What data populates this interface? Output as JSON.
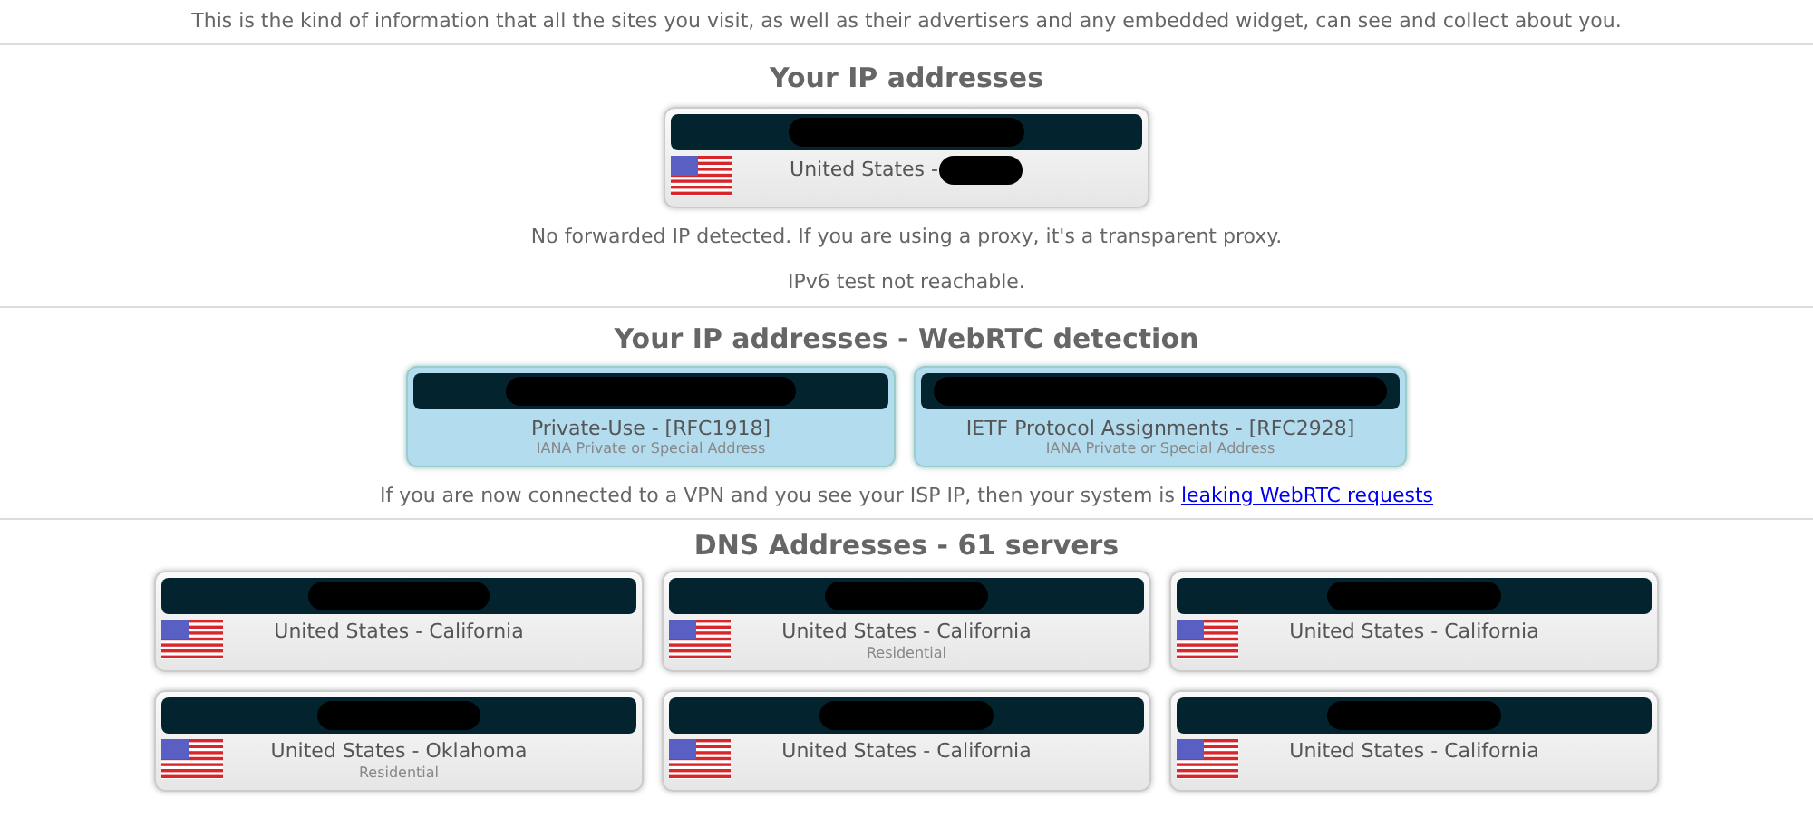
{
  "intro": "This is the kind of information that all the sites you visit, as well as their advertisers and any embedded widget, can see and collect about you.",
  "ip_section": {
    "title": "Your IP addresses",
    "cards": [
      {
        "location": "United States -"
      }
    ],
    "notes": [
      "No forwarded IP detected. If you are using a proxy, it's a transparent proxy.",
      "IPv6 test not reachable."
    ]
  },
  "webrtc_section": {
    "title": "Your IP addresses - WebRTC detection",
    "cards": [
      {
        "title": "Private-Use - [RFC1918]",
        "subtitle": "IANA Private or Special Address"
      },
      {
        "title": "IETF Protocol Assignments - [RFC2928]",
        "subtitle": "IANA Private or Special Address"
      }
    ],
    "note": "If you are now connected to a VPN and you see your ISP IP, then your system is",
    "link": "leaking WebRTC requests"
  },
  "dns_section": {
    "title": "DNS Addresses - 61 servers",
    "cards": [
      {
        "location": "United States - California"
      },
      {
        "location": "United States - California",
        "subtitle": "Residential"
      },
      {
        "location": "United States - California"
      },
      {
        "location": "United States - Oklahoma",
        "subtitle": "Residential"
      },
      {
        "location": "United States - California"
      },
      {
        "location": "United States - California"
      }
    ]
  }
}
